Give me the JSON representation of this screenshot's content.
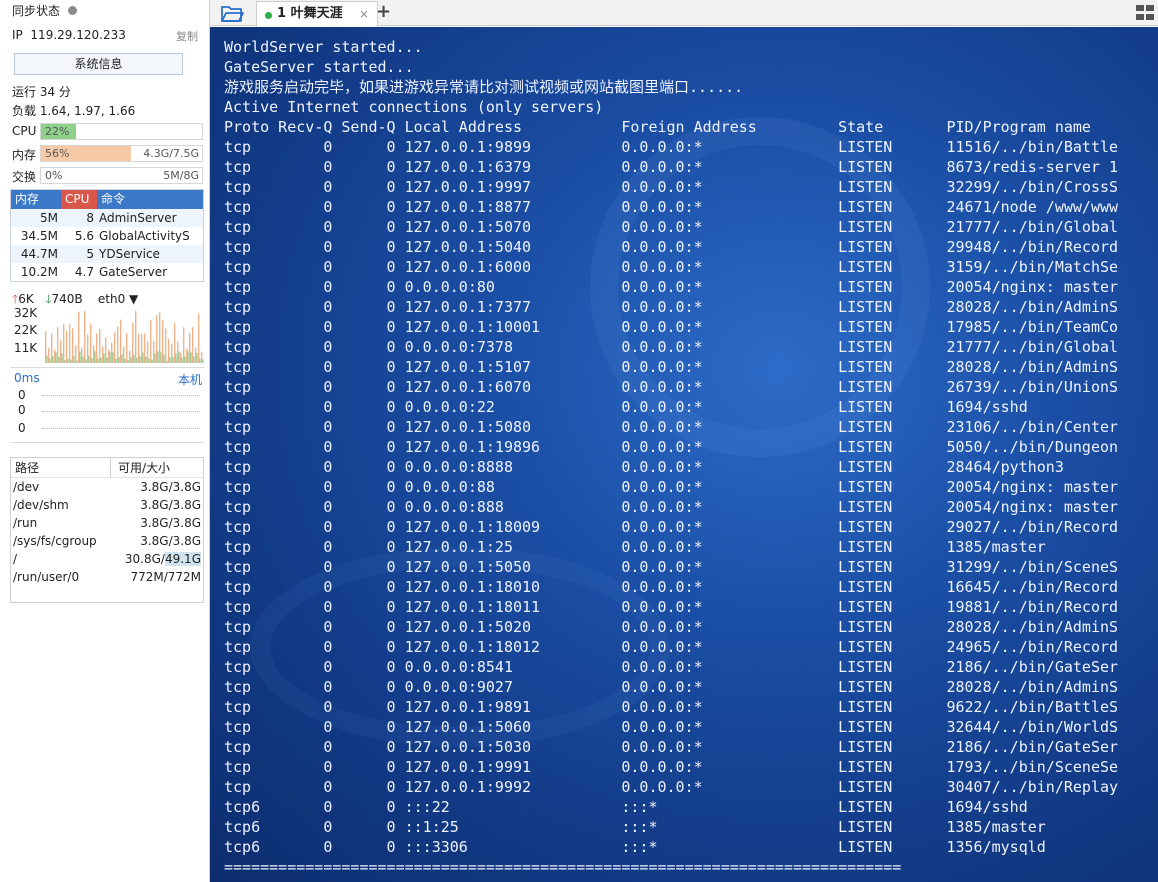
{
  "sidebar": {
    "sync_label": "同步状态",
    "ip_label": "IP",
    "ip_value": "119.29.120.233",
    "copy_label": "复制",
    "sysinfo_button": "系统信息",
    "uptime": "运行 34 分",
    "load": "负载 1.64, 1.97, 1.66",
    "cpu": {
      "label": "CPU",
      "percent_text": "22%",
      "fraction": 0.22,
      "color": "#8fd18b"
    },
    "mem": {
      "label": "内存",
      "percent_text": "56%",
      "fraction": 0.56,
      "used": "4.3G/7.5G",
      "color": "#f6caa6"
    },
    "swap": {
      "label": "交换",
      "percent_text": "0%",
      "fraction": 0.0,
      "used": "5M/8G"
    },
    "proc_table": {
      "headers": {
        "mem": "内存",
        "cpu": "CPU",
        "cmd": "命令"
      },
      "header_colors": {
        "mem": "#3c78c8",
        "cpu": "#d9574a",
        "cmd": "#3c78c8"
      },
      "rows": [
        {
          "mem": "5M",
          "cpu": "8",
          "cmd": "AdminServer"
        },
        {
          "mem": "34.5M",
          "cpu": "5.6",
          "cmd": "GlobalActivityS"
        },
        {
          "mem": "44.7M",
          "cpu": "5",
          "cmd": "YDService"
        },
        {
          "mem": "10.2M",
          "cpu": "4.7",
          "cmd": "GateServer"
        }
      ]
    },
    "network": {
      "upload": "6K",
      "download": "740B",
      "interface": "eth0",
      "axis": [
        "32K",
        "22K",
        "11K"
      ]
    },
    "ping": {
      "latency": "0ms",
      "target": "本机",
      "values": [
        "0",
        "0",
        "0"
      ]
    },
    "disks": {
      "headers": {
        "path": "路径",
        "size": "可用/大小"
      },
      "rows": [
        {
          "path": "/dev",
          "size": "3.8G/3.8G"
        },
        {
          "path": "/dev/shm",
          "size": "3.8G/3.8G"
        },
        {
          "path": "/run",
          "size": "3.8G/3.8G"
        },
        {
          "path": "/sys/fs/cgroup",
          "size": "3.8G/3.8G"
        },
        {
          "path": "/",
          "size_a": "30.8G/",
          "size_b": "49.1G"
        },
        {
          "path": "/run/user/0",
          "size": "772M/772M"
        }
      ]
    }
  },
  "tabs": [
    {
      "label": "1 叶舞天涯",
      "close": "×"
    }
  ],
  "add_tab": "+",
  "terminal": {
    "lines": [
      "WorldServer started...",
      "GateServer started...",
      "游戏服务启动完毕，如果进游戏异常请比对测试视频或网站截图里端口......",
      "Active Internet connections (only servers)",
      "Proto Recv-Q Send-Q Local Address           Foreign Address         State       PID/Program name",
      "tcp        0      0 127.0.0.1:9899          0.0.0.0:*               LISTEN      11516/../bin/Battle",
      "tcp        0      0 127.0.0.1:6379          0.0.0.0:*               LISTEN      8673/redis-server 1",
      "tcp        0      0 127.0.0.1:9997          0.0.0.0:*               LISTEN      32299/../bin/CrossS",
      "tcp        0      0 127.0.0.1:8877          0.0.0.0:*               LISTEN      24671/node /www/www",
      "tcp        0      0 127.0.0.1:5070          0.0.0.0:*               LISTEN      21777/../bin/Global",
      "tcp        0      0 127.0.0.1:5040          0.0.0.0:*               LISTEN      29948/../bin/Record",
      "tcp        0      0 127.0.0.1:6000          0.0.0.0:*               LISTEN      3159/../bin/MatchSe",
      "tcp        0      0 0.0.0.0:80              0.0.0.0:*               LISTEN      20054/nginx: master",
      "tcp        0      0 127.0.0.1:7377          0.0.0.0:*               LISTEN      28028/../bin/AdminS",
      "tcp        0      0 127.0.0.1:10001         0.0.0.0:*               LISTEN      17985/../bin/TeamCo",
      "tcp        0      0 0.0.0.0:7378            0.0.0.0:*               LISTEN      21777/../bin/Global",
      "tcp        0      0 127.0.0.1:5107          0.0.0.0:*               LISTEN      28028/../bin/AdminS",
      "tcp        0      0 127.0.0.1:6070          0.0.0.0:*               LISTEN      26739/../bin/UnionS",
      "tcp        0      0 0.0.0.0:22              0.0.0.0:*               LISTEN      1694/sshd",
      "tcp        0      0 127.0.0.1:5080          0.0.0.0:*               LISTEN      23106/../bin/Center",
      "tcp        0      0 127.0.0.1:19896         0.0.0.0:*               LISTEN      5050/../bin/Dungeon",
      "tcp        0      0 0.0.0.0:8888            0.0.0.0:*               LISTEN      28464/python3",
      "tcp        0      0 0.0.0.0:88              0.0.0.0:*               LISTEN      20054/nginx: master",
      "tcp        0      0 0.0.0.0:888             0.0.0.0:*               LISTEN      20054/nginx: master",
      "tcp        0      0 127.0.0.1:18009         0.0.0.0:*               LISTEN      29027/../bin/Record",
      "tcp        0      0 127.0.0.1:25            0.0.0.0:*               LISTEN      1385/master",
      "tcp        0      0 127.0.0.1:5050          0.0.0.0:*               LISTEN      31299/../bin/SceneS",
      "tcp        0      0 127.0.0.1:18010         0.0.0.0:*               LISTEN      16645/../bin/Record",
      "tcp        0      0 127.0.0.1:18011         0.0.0.0:*               LISTEN      19881/../bin/Record",
      "tcp        0      0 127.0.0.1:5020          0.0.0.0:*               LISTEN      28028/../bin/AdminS",
      "tcp        0      0 127.0.0.1:18012         0.0.0.0:*               LISTEN      24965/../bin/Record",
      "tcp        0      0 0.0.0.0:8541            0.0.0.0:*               LISTEN      2186/../bin/GateSer",
      "tcp        0      0 0.0.0.0:9027            0.0.0.0:*               LISTEN      28028/../bin/AdminS",
      "tcp        0      0 127.0.0.1:9891          0.0.0.0:*               LISTEN      9622/../bin/BattleS",
      "tcp        0      0 127.0.0.1:5060          0.0.0.0:*               LISTEN      32644/../bin/WorldS",
      "tcp        0      0 127.0.0.1:5030          0.0.0.0:*               LISTEN      2186/../bin/GateSer",
      "tcp        0      0 127.0.0.1:9991          0.0.0.0:*               LISTEN      1793/../bin/SceneSe",
      "tcp        0      0 127.0.0.1:9992          0.0.0.0:*               LISTEN      30407/../bin/Replay",
      "tcp6       0      0 :::22                   :::*                    LISTEN      1694/sshd",
      "tcp6       0      0 ::1:25                  :::*                    LISTEN      1385/master",
      "tcp6       0      0 :::3306                 :::*                    LISTEN      1356/mysqld",
      "==========================================================================="
    ]
  }
}
